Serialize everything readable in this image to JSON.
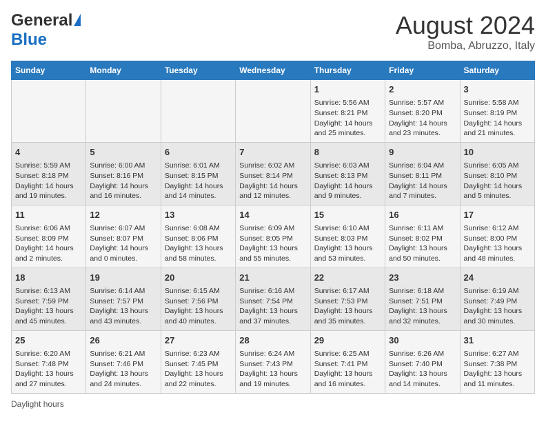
{
  "header": {
    "logo_general": "General",
    "logo_blue": "Blue",
    "title": "August 2024",
    "subtitle": "Bomba, Abruzzo, Italy"
  },
  "days_of_week": [
    "Sunday",
    "Monday",
    "Tuesday",
    "Wednesday",
    "Thursday",
    "Friday",
    "Saturday"
  ],
  "weeks": [
    [
      {
        "day": "",
        "info": ""
      },
      {
        "day": "",
        "info": ""
      },
      {
        "day": "",
        "info": ""
      },
      {
        "day": "",
        "info": ""
      },
      {
        "day": "1",
        "info": "Sunrise: 5:56 AM\nSunset: 8:21 PM\nDaylight: 14 hours and 25 minutes."
      },
      {
        "day": "2",
        "info": "Sunrise: 5:57 AM\nSunset: 8:20 PM\nDaylight: 14 hours and 23 minutes."
      },
      {
        "day": "3",
        "info": "Sunrise: 5:58 AM\nSunset: 8:19 PM\nDaylight: 14 hours and 21 minutes."
      }
    ],
    [
      {
        "day": "4",
        "info": "Sunrise: 5:59 AM\nSunset: 8:18 PM\nDaylight: 14 hours and 19 minutes."
      },
      {
        "day": "5",
        "info": "Sunrise: 6:00 AM\nSunset: 8:16 PM\nDaylight: 14 hours and 16 minutes."
      },
      {
        "day": "6",
        "info": "Sunrise: 6:01 AM\nSunset: 8:15 PM\nDaylight: 14 hours and 14 minutes."
      },
      {
        "day": "7",
        "info": "Sunrise: 6:02 AM\nSunset: 8:14 PM\nDaylight: 14 hours and 12 minutes."
      },
      {
        "day": "8",
        "info": "Sunrise: 6:03 AM\nSunset: 8:13 PM\nDaylight: 14 hours and 9 minutes."
      },
      {
        "day": "9",
        "info": "Sunrise: 6:04 AM\nSunset: 8:11 PM\nDaylight: 14 hours and 7 minutes."
      },
      {
        "day": "10",
        "info": "Sunrise: 6:05 AM\nSunset: 8:10 PM\nDaylight: 14 hours and 5 minutes."
      }
    ],
    [
      {
        "day": "11",
        "info": "Sunrise: 6:06 AM\nSunset: 8:09 PM\nDaylight: 14 hours and 2 minutes."
      },
      {
        "day": "12",
        "info": "Sunrise: 6:07 AM\nSunset: 8:07 PM\nDaylight: 14 hours and 0 minutes."
      },
      {
        "day": "13",
        "info": "Sunrise: 6:08 AM\nSunset: 8:06 PM\nDaylight: 13 hours and 58 minutes."
      },
      {
        "day": "14",
        "info": "Sunrise: 6:09 AM\nSunset: 8:05 PM\nDaylight: 13 hours and 55 minutes."
      },
      {
        "day": "15",
        "info": "Sunrise: 6:10 AM\nSunset: 8:03 PM\nDaylight: 13 hours and 53 minutes."
      },
      {
        "day": "16",
        "info": "Sunrise: 6:11 AM\nSunset: 8:02 PM\nDaylight: 13 hours and 50 minutes."
      },
      {
        "day": "17",
        "info": "Sunrise: 6:12 AM\nSunset: 8:00 PM\nDaylight: 13 hours and 48 minutes."
      }
    ],
    [
      {
        "day": "18",
        "info": "Sunrise: 6:13 AM\nSunset: 7:59 PM\nDaylight: 13 hours and 45 minutes."
      },
      {
        "day": "19",
        "info": "Sunrise: 6:14 AM\nSunset: 7:57 PM\nDaylight: 13 hours and 43 minutes."
      },
      {
        "day": "20",
        "info": "Sunrise: 6:15 AM\nSunset: 7:56 PM\nDaylight: 13 hours and 40 minutes."
      },
      {
        "day": "21",
        "info": "Sunrise: 6:16 AM\nSunset: 7:54 PM\nDaylight: 13 hours and 37 minutes."
      },
      {
        "day": "22",
        "info": "Sunrise: 6:17 AM\nSunset: 7:53 PM\nDaylight: 13 hours and 35 minutes."
      },
      {
        "day": "23",
        "info": "Sunrise: 6:18 AM\nSunset: 7:51 PM\nDaylight: 13 hours and 32 minutes."
      },
      {
        "day": "24",
        "info": "Sunrise: 6:19 AM\nSunset: 7:49 PM\nDaylight: 13 hours and 30 minutes."
      }
    ],
    [
      {
        "day": "25",
        "info": "Sunrise: 6:20 AM\nSunset: 7:48 PM\nDaylight: 13 hours and 27 minutes."
      },
      {
        "day": "26",
        "info": "Sunrise: 6:21 AM\nSunset: 7:46 PM\nDaylight: 13 hours and 24 minutes."
      },
      {
        "day": "27",
        "info": "Sunrise: 6:23 AM\nSunset: 7:45 PM\nDaylight: 13 hours and 22 minutes."
      },
      {
        "day": "28",
        "info": "Sunrise: 6:24 AM\nSunset: 7:43 PM\nDaylight: 13 hours and 19 minutes."
      },
      {
        "day": "29",
        "info": "Sunrise: 6:25 AM\nSunset: 7:41 PM\nDaylight: 13 hours and 16 minutes."
      },
      {
        "day": "30",
        "info": "Sunrise: 6:26 AM\nSunset: 7:40 PM\nDaylight: 13 hours and 14 minutes."
      },
      {
        "day": "31",
        "info": "Sunrise: 6:27 AM\nSunset: 7:38 PM\nDaylight: 13 hours and 11 minutes."
      }
    ]
  ],
  "footer": {
    "daylight_label": "Daylight hours"
  }
}
